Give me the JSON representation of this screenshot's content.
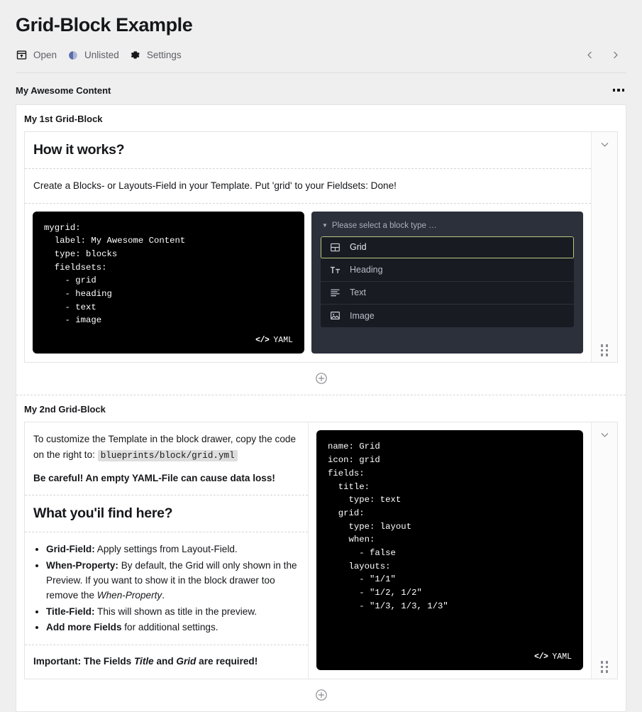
{
  "header": {
    "title": "Grid-Block Example",
    "actions": [
      {
        "label": "Open",
        "icon": "open-preview-icon"
      },
      {
        "label": "Unlisted",
        "icon": "half-circle-status-icon"
      },
      {
        "label": "Settings",
        "icon": "gear-icon"
      }
    ],
    "prev_label": "‹",
    "next_label": "›"
  },
  "field": {
    "label": "My Awesome Content",
    "options_label": "•••"
  },
  "blocks": [
    {
      "title": "My 1st Grid-Block",
      "heading": "How it works?",
      "intro": "Create a Blocks- or Layouts-Field in your Template. Put 'grid' to your Fieldsets: Done!",
      "code": {
        "language": "YAML",
        "text": "mygrid:\n  label: My Awesome Content\n  type: blocks\n  fieldsets:\n    - grid\n    - heading\n    - text\n    - image"
      },
      "picker": {
        "label": "Please select a block type …",
        "items": [
          {
            "label": "Grid",
            "icon": "grid-block-icon",
            "selected": true
          },
          {
            "label": "Heading",
            "icon": "heading-text-icon",
            "selected": false
          },
          {
            "label": "Text",
            "icon": "text-lines-icon",
            "selected": false
          },
          {
            "label": "Image",
            "icon": "image-icon",
            "selected": false
          }
        ]
      }
    },
    {
      "title": "My 2nd Grid-Block",
      "intro_part1": "To customize the Template in the block drawer, copy the code on the right to:",
      "intro_code": "blueprints/block/grid.yml",
      "warning": "Be careful! An empty YAML-File can cause data loss!",
      "heading": "What you'il find here?",
      "list": [
        {
          "term": "Grid-Field:",
          "rest": " Apply settings from Layout-Field."
        },
        {
          "term": "When-Property:",
          "rest": " By default, the Grid will only shown in the Preview. If you want to show it in the block drawer too remove the ",
          "italic": "When-Property",
          "tail": "."
        },
        {
          "term": "Title-Field:",
          "rest": " This will shown as title in the preview."
        },
        {
          "term": "Add more Fields",
          "rest": " for additional settings."
        }
      ],
      "important_prefix": "Important: The Fields ",
      "important_italic1": "Title",
      "important_mid": " and ",
      "important_italic2": "Grid",
      "important_suffix": " are required!",
      "code": {
        "language": "YAML",
        "text": "name: Grid\nicon: grid\nfields:\n  title:\n    type: text\n  grid:\n    type: layout\n    when:\n      - false\n    layouts:\n      - \"1/1\"\n      - \"1/2, 1/2\"\n      - \"1/3, 1/3, 1/3\""
      }
    }
  ],
  "colors": {
    "page_bg": "#efefef",
    "code_bg": "#000000",
    "picker_bg": "#2b303b",
    "picker_item_bg": "#181b22",
    "picker_selected_border": "#b9c97e"
  }
}
